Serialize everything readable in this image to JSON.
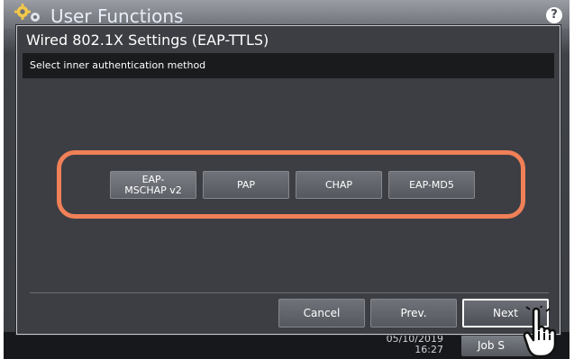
{
  "app": {
    "title": "User Functions",
    "help_label": "?",
    "footer_date": "05/10/2019",
    "footer_time": "16:27",
    "job_status_label": "Job S"
  },
  "dialog": {
    "title": "Wired 802.1X Settings (EAP-TTLS)",
    "instruction": "Select inner authentication method"
  },
  "options": [
    {
      "label": "EAP-MSCHAP v2"
    },
    {
      "label": "PAP"
    },
    {
      "label": "CHAP"
    },
    {
      "label": "EAP-MD5"
    }
  ],
  "nav": {
    "cancel_label": "Cancel",
    "prev_label": "Prev.",
    "next_label": "Next"
  },
  "colors": {
    "highlight": "#f08058",
    "dialog_bg": "#3c3e43",
    "button_bg": "#62656b"
  },
  "icons": {
    "app": "gear-icon",
    "help": "help-icon",
    "pointer": "hand-pointer-icon"
  }
}
